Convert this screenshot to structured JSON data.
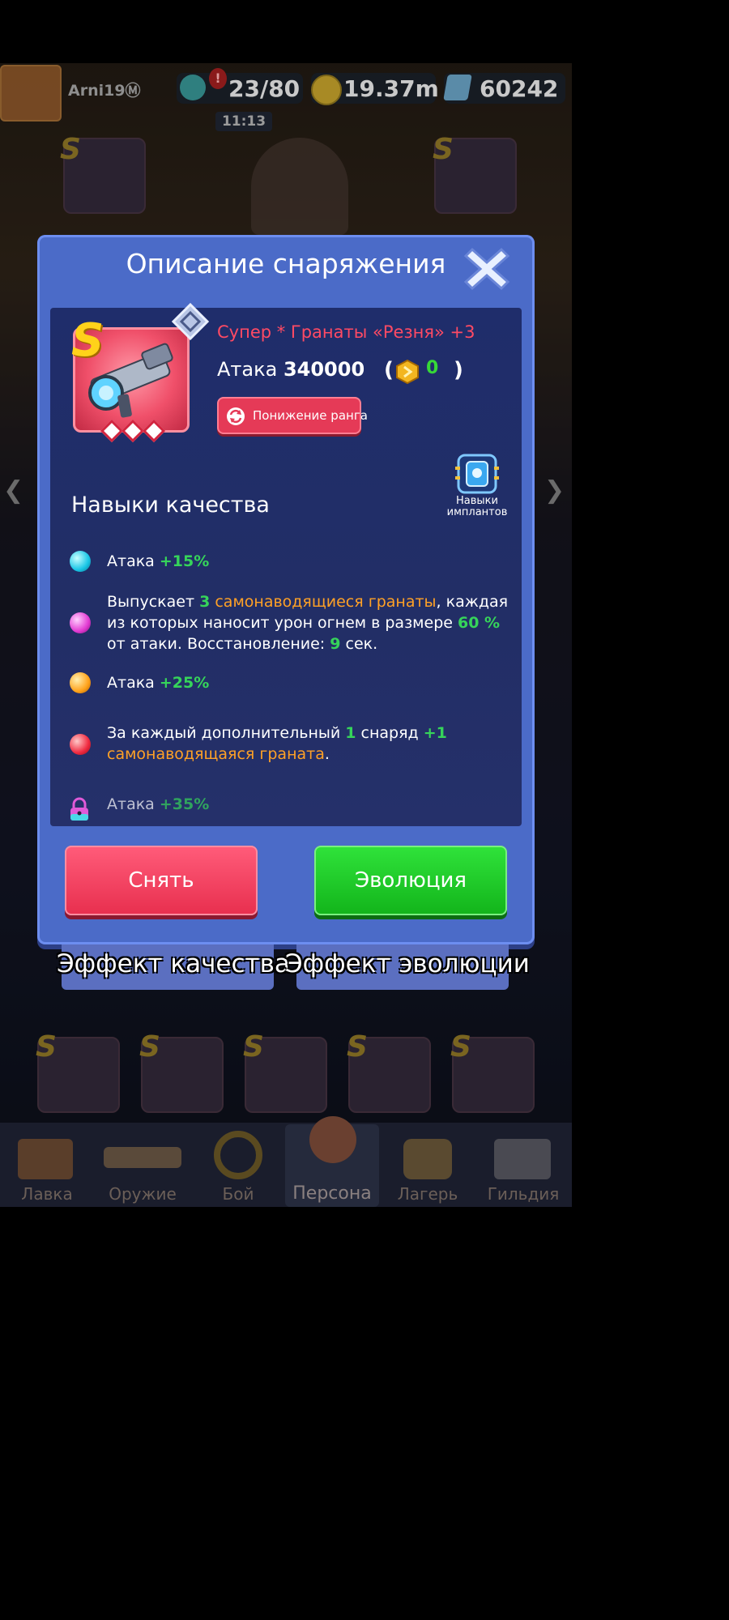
{
  "hud": {
    "player_name": "Arni19Ⓜ",
    "energy": "23/80",
    "gold": "19.37m",
    "gems": "60242",
    "timer": "11:13",
    "alert": "!"
  },
  "dialog": {
    "title": "Описание снаряжения",
    "item": {
      "rank": "S",
      "name": "Супер * Гранаты «Резня» +3",
      "attack_label": "Атака",
      "attack_value": "340000",
      "paren_open": "(",
      "paren_close": ")",
      "token_value": "0"
    },
    "downgrade_label": "Понижение ранга",
    "implants_label": "Навыки имплантов",
    "skills_title": "Навыки качества",
    "skills": {
      "s1": {
        "pre": "Атака ",
        "val": "+15%"
      },
      "s2": {
        "t1": "Выпускает ",
        "n1": "3",
        "t2": " ",
        "o1": "самонаводящиеся гранаты",
        "t3": ", каждая из которых наносит урон огнем в размере ",
        "n2": "60 %",
        "t4": " от атаки. Восстановление: ",
        "n3": "9",
        "t5": " сек."
      },
      "s3": {
        "pre": "Атака ",
        "val": "+25%"
      },
      "s4": {
        "t1": "За каждый дополнительный ",
        "n1": "1",
        "t2": " снаряд ",
        "n2": "+1",
        "o1": "самонаводящаяся граната",
        "t3": "."
      },
      "s5": {
        "pre": "Атака ",
        "val": "+35%"
      }
    },
    "remove_label": "Снять",
    "evolve_label": "Эволюция"
  },
  "tabs": {
    "quality": "Эффект качества",
    "evolution": "Эффект эволюции"
  },
  "bottom_nav": [
    "Лавка",
    "Оружие",
    "Бой",
    "Персона",
    "Лагерь",
    "Гильдия"
  ],
  "colors": {
    "dialog_bg": "#4b6bc8",
    "panel_bg": "#222e66",
    "accent_red": "#ff4a64",
    "value_green": "#36d45a",
    "highlight_orange": "#ffa126",
    "remove_button": "#e8304f",
    "evolve_button": "#13b51b"
  }
}
